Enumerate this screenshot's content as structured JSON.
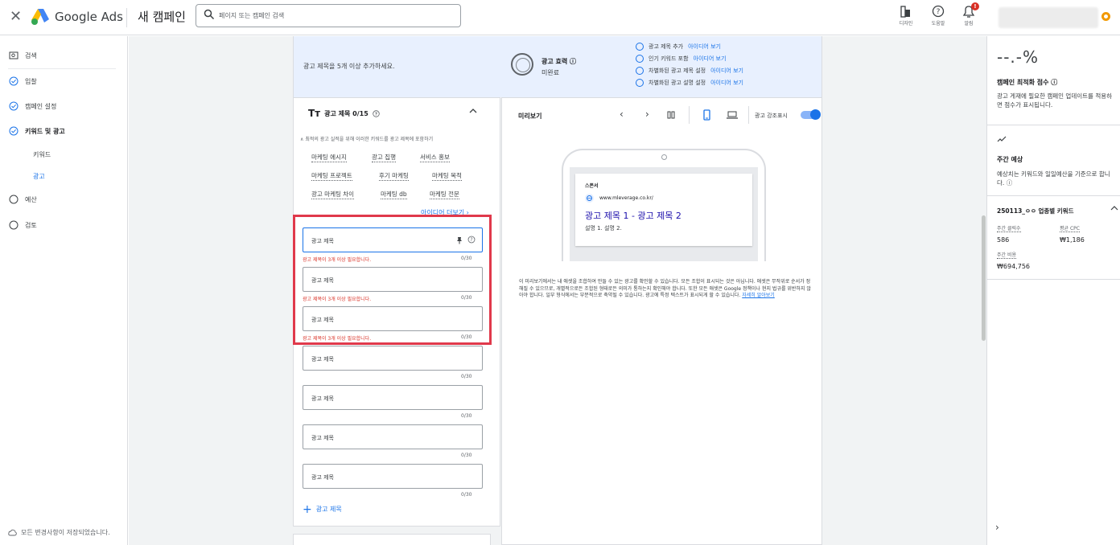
{
  "topbar": {
    "brand": "Google Ads",
    "page_title": "새 캠페인",
    "search_placeholder": "페이지 또는 캠페인 검색",
    "icons": [
      {
        "name": "appearance-icon",
        "label": "디자인"
      },
      {
        "name": "help-icon",
        "label": "도움말"
      },
      {
        "name": "notifications-icon",
        "label": "알림",
        "badge": "!"
      }
    ]
  },
  "nav": {
    "items": [
      {
        "label": "검색",
        "icon": "search-campaign-icon"
      },
      {
        "label": "입찰",
        "icon": "check-circle-icon"
      },
      {
        "label": "캠페인 설정",
        "icon": "check-circle-icon"
      },
      {
        "label": "키워드 및 광고",
        "icon": "check-circle-icon"
      },
      {
        "label": "예산",
        "icon": "empty-circle-icon"
      },
      {
        "label": "검토",
        "icon": "empty-circle-icon"
      }
    ],
    "sub": [
      "키워드",
      "광고"
    ],
    "saved": "모든 변경사항이 저장되었습니다."
  },
  "banner": {
    "message": "광고 제목을 5개 이상 추가하세요.",
    "strength_title": "광고 효력",
    "strength_status": "미완료",
    "checklist": [
      {
        "label": "광고 제목 추가",
        "link": "아이디어 보기"
      },
      {
        "label": "인기 키워드 포함",
        "link": "아이디어 보기"
      },
      {
        "label": "차별화된 광고 제목 설정",
        "link": "아이디어 보기"
      },
      {
        "label": "차별화된 광고 설명 설정",
        "link": "아이디어 보기"
      }
    ]
  },
  "headlines": {
    "title": "광고 제목 0/15",
    "keyword_hint": "최적의 광고 실적을 위해 이러한 키워드를 광고 제목에 포함하기",
    "chips": [
      "마케팅 에시지",
      "광고 집행",
      "서비스 홍보",
      "마케팅 프로젝트",
      "후기 마케팅",
      "마케팅 목적",
      "광고 마케팅 차이",
      "마케팅 db",
      "마케팅 전문"
    ],
    "more_ideas": "아이디어 더보기",
    "placeholder": "광고 제목",
    "error": "광고 제목이 3개 이상 필요합니다.",
    "counter": "0/30",
    "add_label": "광고 제목"
  },
  "preview": {
    "title": "미리보기",
    "highlight_label": "광고 강조표시",
    "highlight_on": true,
    "ad": {
      "sponsor": "스폰서",
      "url": "www.mleverage.co.kr/",
      "headline": "광고 제목 1 - 광고 제목 2",
      "description": "설명 1. 설명 2."
    },
    "note": "이 미리보기에서는 내 애셋을 조합하여 만들 수 있는 광고를 확인할 수 있습니다. 모든 조합이 표시되는 것은 아닙니다. 애셋은 무작위로 순서가 정해질 수 있으므로, 개별적으로든 조합된 형태로든 의미가 통하는지 확인해야 합니다. 또한 모든 애셋은 Google 정책이나 현지 법규를 위반하지 않아야 합니다. 일부 형식에서는 부분적으로 축약될 수 있습니다. 광고에 특정 텍스트가 표시되게 할 수 있습니다.",
    "note_link": "자세히 알아보기"
  },
  "right": {
    "score": "--.-%",
    "opt_title": "캠페인 최적화 점수",
    "opt_desc": "광고 게재에 필요한 캠페인 업데이트를 적용하면 점수가 표시됩니다.",
    "forecast_title": "주간 예상",
    "forecast_desc": "예상치는 키워드와 일일예산을 기준으로 합니다.",
    "keyword_group": "250113_ㅇㅇ 업종별 키워드",
    "stats": [
      {
        "label": "주간 클릭수",
        "value": "586"
      },
      {
        "label": "평균 CPC",
        "value": "₩1,186"
      },
      {
        "label": "주간 비용",
        "value": "₩694,756"
      }
    ]
  },
  "colors": {
    "accent": "#1a73e8",
    "error": "#d93025",
    "highlight_box": "#e0394b",
    "banner_bg": "#e8f0fe"
  }
}
